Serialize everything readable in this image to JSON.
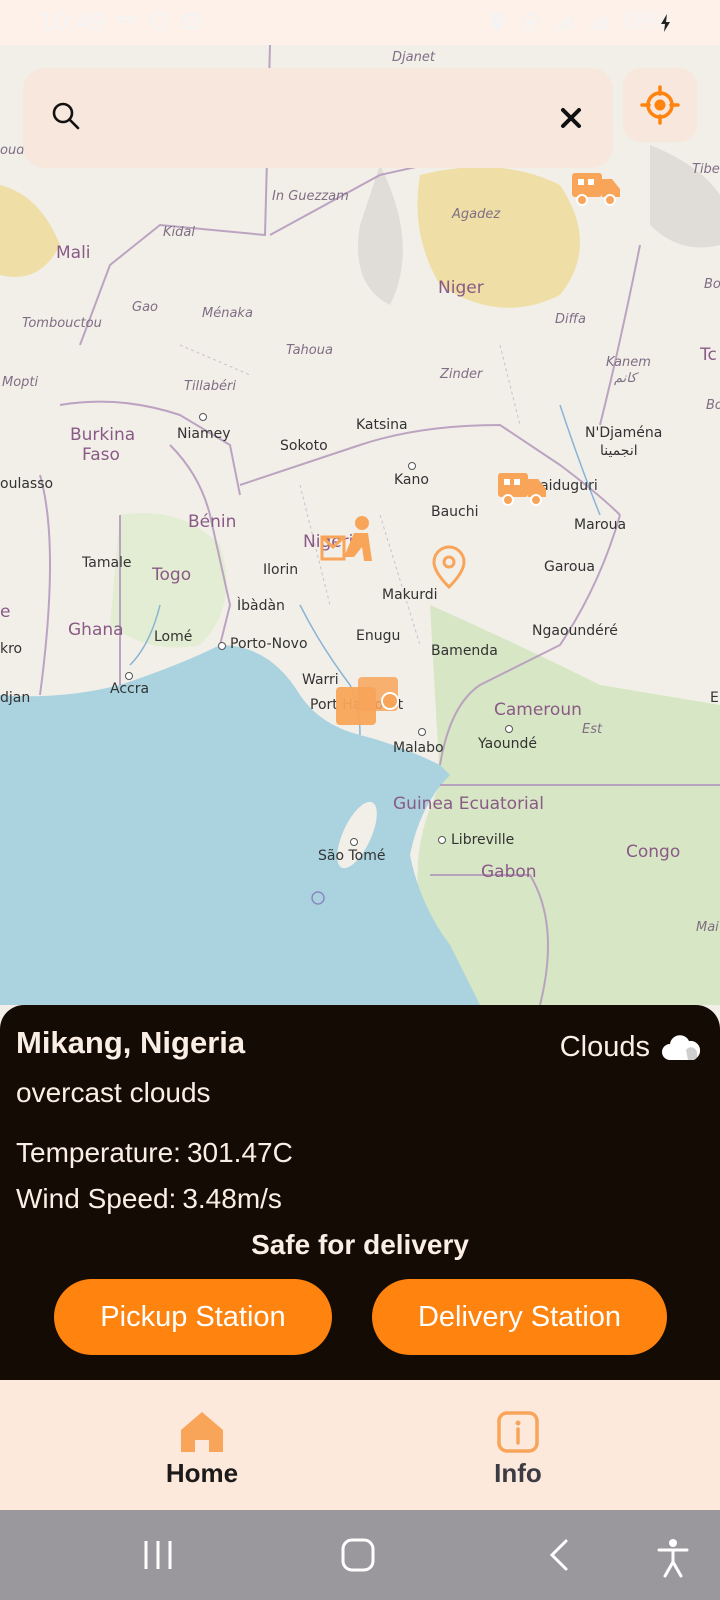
{
  "status_bar": {
    "time": "10:49",
    "battery": "68%"
  },
  "map": {
    "countries": [
      "Mali",
      "Niger",
      "Burkina Faso",
      "Bénin",
      "Togo",
      "Ghana",
      "Nigeria",
      "Cameroun",
      "Guinea Ecuatorial",
      "Gabon",
      "Congo"
    ],
    "labels": {
      "djanet": "Djanet",
      "in_guezzam": "In Guezzam",
      "agadez": "Agadez",
      "kidal": "Kidal",
      "mali": "Mali",
      "niger": "Niger",
      "gao": "Gao",
      "menaka": "Ménaka",
      "tombouctou": "Tombouctou",
      "tahoua": "Tahoua",
      "diffa": "Diffa",
      "kanem": "Kanem",
      "kanem_ar": "كانم",
      "mopti": "Mopti",
      "tillaberi": "Tillabéri",
      "zinder": "Zinder",
      "burkina": "Burkina",
      "faso": "Faso",
      "niamey": "Niamey",
      "sokoto": "Sokoto",
      "katsina": "Katsina",
      "ndjamena": "N'Djaména",
      "ndjamena_ar": "انجمينا",
      "oulasso": "oulasso",
      "kano": "Kano",
      "maiduguri": "Maiduguri",
      "benin": "Bénin",
      "bauchi": "Bauchi",
      "maroua": "Maroua",
      "tamale": "Tamale",
      "nigeria": "Nigeria",
      "togo": "Togo",
      "ilorin": "Ilorin",
      "makurdi": "Makurdi",
      "garoua": "Garoua",
      "ibadan": "Ìbàdàn",
      "ghana": "Ghana",
      "lome": "Lomé",
      "porto_novo": "Porto-Novo",
      "enugu": "Enugu",
      "bamenda": "Bamenda",
      "ngaoundere": "Ngaoundéré",
      "kro": "kro",
      "accra": "Accra",
      "warri": "Warri",
      "port_harcourt": "Port Harcourt",
      "cameroun": "Cameroun",
      "djan": "djan",
      "est": "Est",
      "malabo": "Malabo",
      "yaounde": "Yaoundé",
      "guinea_ecuatorial": "Guinea Ecuatorial",
      "libreville": "Libreville",
      "sao_tome": "São Tomé",
      "gabon": "Gabon",
      "congo": "Congo",
      "tibe": "Tibe",
      "bo": "Bo",
      "tc": "Tc",
      "bo2": "Bo",
      "ouda": "oude",
      "e": "e",
      "mai": "Mai",
      "e2": "E"
    }
  },
  "search": {
    "value": "",
    "placeholder": ""
  },
  "weather": {
    "place": "Mikang, Nigeria",
    "description": "overcast clouds",
    "main": "Clouds",
    "temperature_label": "Temperature:",
    "temperature_value": "301.47C",
    "wind_label": "Wind Speed:",
    "wind_value": "3.48m/s",
    "status": "Safe for delivery"
  },
  "actions": {
    "pickup": "Pickup Station",
    "delivery": "Delivery Station"
  },
  "nav": {
    "home": "Home",
    "info": "Info"
  },
  "colors": {
    "accent": "#ff830f",
    "panel_bg": "#150b05",
    "nav_bg": "#fde8dc",
    "search_bg": "#f7e7dc",
    "marker": "#f8a55a"
  }
}
